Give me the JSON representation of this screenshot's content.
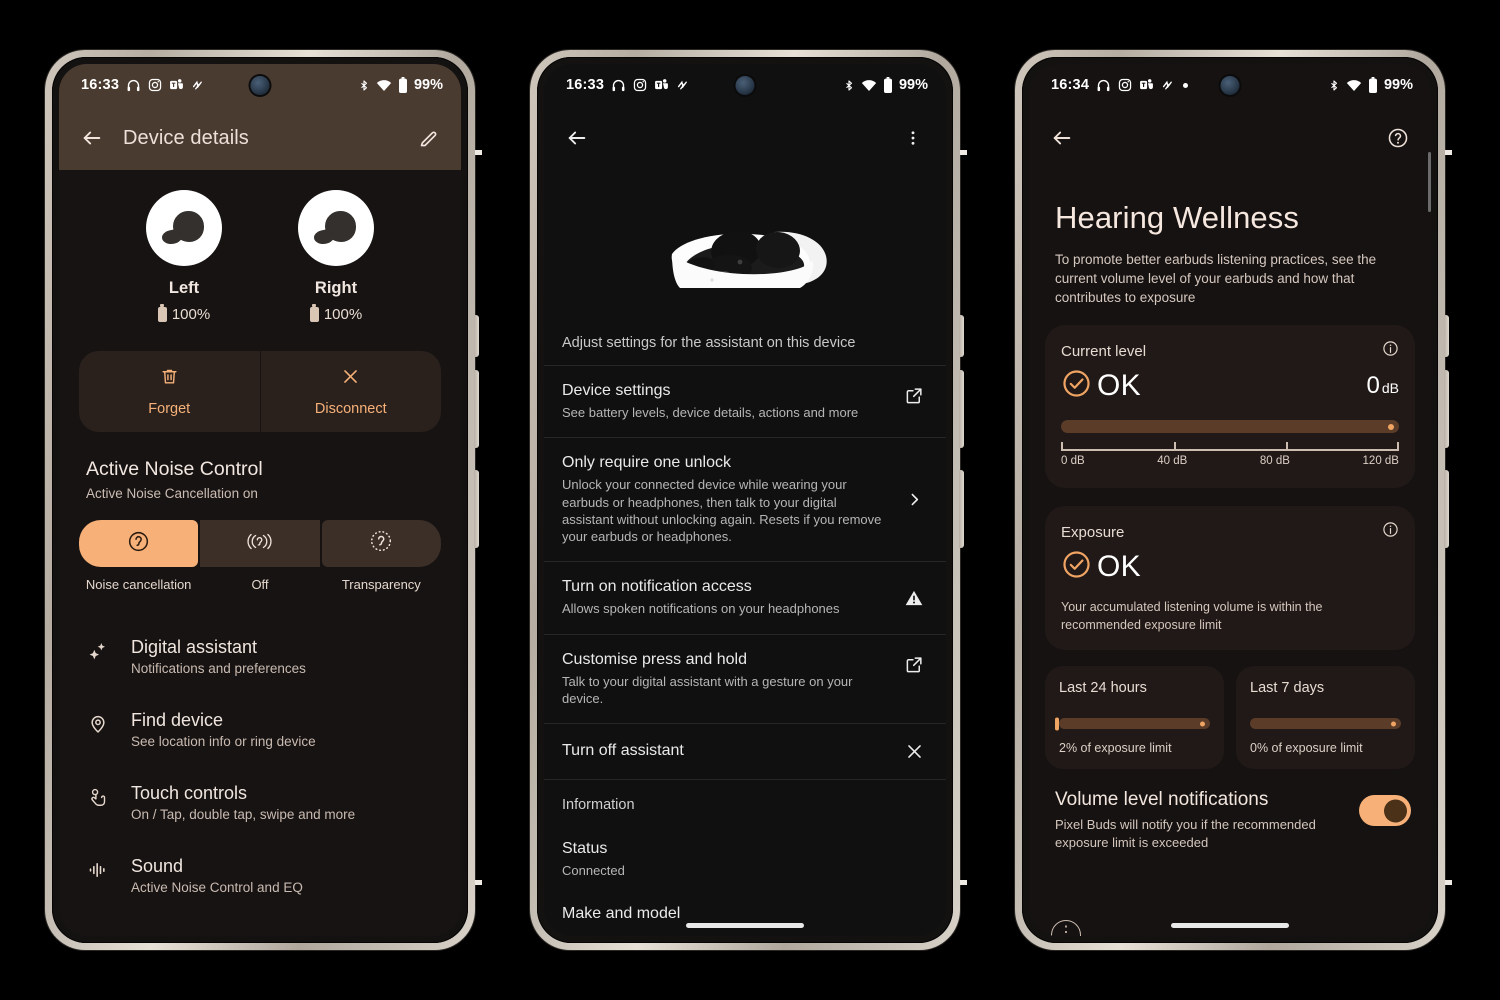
{
  "theme": {
    "accent": "#f7b077",
    "screen1_bg": "#171312",
    "screen1_appbar_bg": "#4a3b31",
    "screen2_bg": "#101010",
    "screen3_bg": "#151211",
    "card_bg": "#201917",
    "bar_track": "#5a3c28"
  },
  "phone1": {
    "status": {
      "time": "16:33",
      "battery_pct": "99%",
      "left_icons": [
        "headphones-icon",
        "instagram-icon",
        "teams-icon",
        "squiggle-icon"
      ],
      "right_icons": [
        "bluetooth-icon",
        "wifi-icon",
        "battery-icon"
      ]
    },
    "appbar": {
      "title": "Device details",
      "back": "back-arrow-icon",
      "edit": "edit-pencil-icon"
    },
    "buds": [
      {
        "label": "Left",
        "battery": "100%"
      },
      {
        "label": "Right",
        "battery": "100%"
      }
    ],
    "actions": [
      {
        "label": "Forget",
        "icon": "trash-icon"
      },
      {
        "label": "Disconnect",
        "icon": "close-x-icon"
      }
    ],
    "anc": {
      "title": "Active Noise Control",
      "subtitle": "Active Noise Cancellation on",
      "modes": [
        {
          "label": "Noise cancellation",
          "icon": "ear-solid-icon",
          "active": true
        },
        {
          "label": "Off",
          "icon": "ear-brackets-icon",
          "active": false
        },
        {
          "label": "Transparency",
          "icon": "ear-dotted-icon",
          "active": false
        }
      ]
    },
    "list": [
      {
        "title": "Digital assistant",
        "subtitle": "Notifications and preferences",
        "icon": "sparkle-icon"
      },
      {
        "title": "Find device",
        "subtitle": "See location info or ring device",
        "icon": "location-pin-icon"
      },
      {
        "title": "Touch controls",
        "subtitle": "On / Tap, double tap, swipe and more",
        "icon": "touch-gesture-icon"
      },
      {
        "title": "Sound",
        "subtitle": "Active Noise Control and EQ",
        "icon": "sound-wave-icon"
      }
    ]
  },
  "phone2": {
    "status": {
      "time": "16:33",
      "battery_pct": "99%"
    },
    "appbar": {
      "back": "back-arrow-icon",
      "overflow": "more-vertical-icon"
    },
    "hero": {
      "image": "earbuds-case-image",
      "caption": "Adjust settings for the assistant on this device"
    },
    "rows": [
      {
        "title": "Device settings",
        "subtitle": "See battery levels, device details, actions and more",
        "trailing": "open-external-icon"
      },
      {
        "title": "Only require one unlock",
        "subtitle": "Unlock your connected device while wearing your earbuds or headphones, then talk to your digital assistant without unlocking again. Resets if you remove your earbuds or headphones.",
        "trailing": "chevron-right-icon"
      },
      {
        "title": "Turn on notification access",
        "subtitle": "Allows spoken notifications on your headphones",
        "trailing": "warning-triangle-icon"
      },
      {
        "title": "Customise press and hold",
        "subtitle": "Talk to your digital assistant with a gesture on your device.",
        "trailing": "open-external-icon"
      },
      {
        "title": "Turn off assistant",
        "subtitle": "",
        "trailing": "close-x-icon"
      },
      {
        "title": "Information",
        "subtitle": "",
        "trailing": ""
      },
      {
        "title": "Status",
        "subtitle": "Connected",
        "trailing": ""
      },
      {
        "title": "Make and model",
        "subtitle": "",
        "trailing": ""
      }
    ]
  },
  "phone3": {
    "status": {
      "time": "16:34",
      "battery_pct": "99%"
    },
    "appbar": {
      "back": "back-arrow-icon",
      "help": "help-circle-icon"
    },
    "page_title": "Hearing Wellness",
    "page_desc": "To promote better earbuds listening practices, see the current volume level of your earbuds and how that contributes to exposure",
    "current_level": {
      "title": "Current level",
      "info_icon": "info-circle-icon",
      "status": "OK",
      "status_icon": "check-circle-icon",
      "value": "0",
      "unit": "dB",
      "scale_labels": [
        "0 dB",
        "40 dB",
        "80 dB",
        "120 dB"
      ]
    },
    "exposure": {
      "title": "Exposure",
      "info_icon": "info-circle-icon",
      "status": "OK",
      "status_icon": "check-circle-icon",
      "note": "Your accumulated listening volume is within the recommended exposure limit"
    },
    "mini_cards": [
      {
        "title": "Last 24 hours",
        "note": "2% of exposure limit",
        "pct": 2
      },
      {
        "title": "Last 7 days",
        "note": "0% of exposure limit",
        "pct": 0
      }
    ],
    "volume_notifications": {
      "title": "Volume level notifications",
      "subtitle": "Pixel Buds will notify you if the recommended exposure limit is exceeded",
      "enabled": true
    }
  },
  "chart_data": {
    "type": "bar",
    "title": "Hearing Wellness exposure meters",
    "categories": [
      "Current level (dB)",
      "Last 24 hours (% of limit)",
      "Last 7 days (% of limit)"
    ],
    "values": [
      0,
      2,
      0
    ],
    "xlabel": "",
    "ylabel": "",
    "axis_ticks": [
      "0 dB",
      "40 dB",
      "80 dB",
      "120 dB"
    ],
    "ylim": [
      0,
      120
    ]
  }
}
